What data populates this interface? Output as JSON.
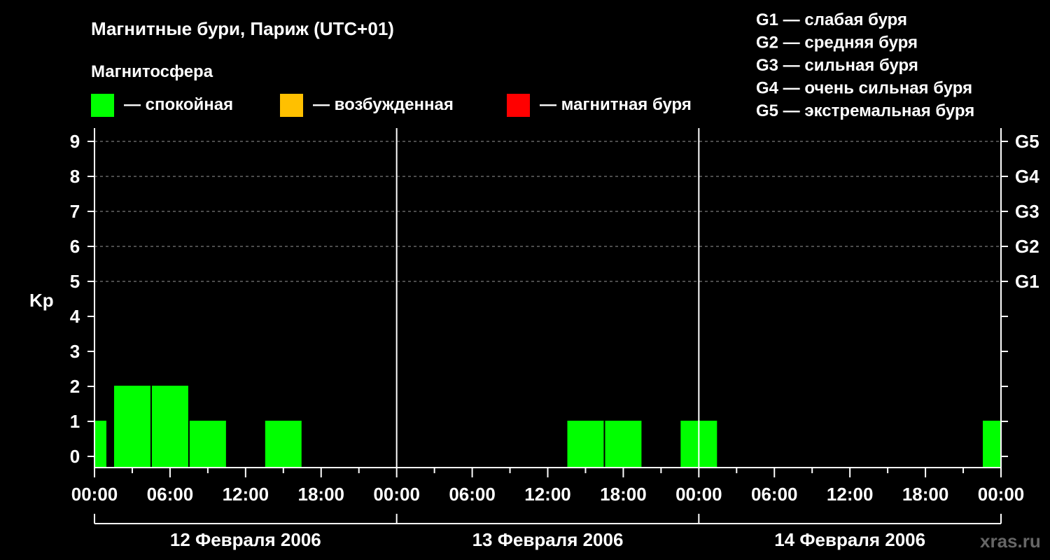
{
  "chart_data": {
    "type": "bar",
    "title": "Магнитные бури, Париж (UTC+01)",
    "subtitle": "Магнитосфера",
    "ylabel": "Kp",
    "xlabel": "",
    "ylim": [
      0,
      9
    ],
    "y_ticks": [
      "0",
      "1",
      "2",
      "3",
      "4",
      "5",
      "6",
      "7",
      "8",
      "9"
    ],
    "x_range_hours": [
      0,
      72
    ],
    "x_ticks": [
      "00:00",
      "06:00",
      "12:00",
      "18:00",
      "00:00",
      "06:00",
      "12:00",
      "18:00",
      "00:00",
      "06:00",
      "12:00",
      "18:00",
      "00:00"
    ],
    "days": [
      "12 Февраля 2006",
      "13 Февраля 2006",
      "14 Февраля 2006"
    ],
    "g_levels": [
      {
        "kp": 5,
        "label": "G1"
      },
      {
        "kp": 6,
        "label": "G2"
      },
      {
        "kp": 7,
        "label": "G3"
      },
      {
        "kp": 8,
        "label": "G4"
      },
      {
        "kp": 9,
        "label": "G5"
      }
    ],
    "legend": [
      {
        "label": "— спокойная",
        "color": "#00ff00"
      },
      {
        "label": "— возбужденная",
        "color": "#ffc000"
      },
      {
        "label": "— магнитная буря",
        "color": "#ff0000"
      }
    ],
    "g_legend": [
      "G1 — слабая буря",
      "G2 — средняя буря",
      "G3 — сильная буря",
      "G4 — очень сильная буря",
      "G5 — экстремальная буря"
    ],
    "bar_color": "#00ff00",
    "series": [
      {
        "start_hour": [
          0,
          1.5,
          4.5,
          7.5,
          13.5,
          37.5,
          40.5,
          46.5,
          70.5
        ],
        "end_hour": [
          1,
          4.5,
          7.5,
          10.5,
          16.5,
          40.5,
          43.5,
          49.5,
          72
        ],
        "values": [
          1,
          2,
          2,
          1,
          1,
          1,
          1,
          1,
          1
        ]
      }
    ],
    "grid": true
  },
  "watermark": "xras.ru"
}
